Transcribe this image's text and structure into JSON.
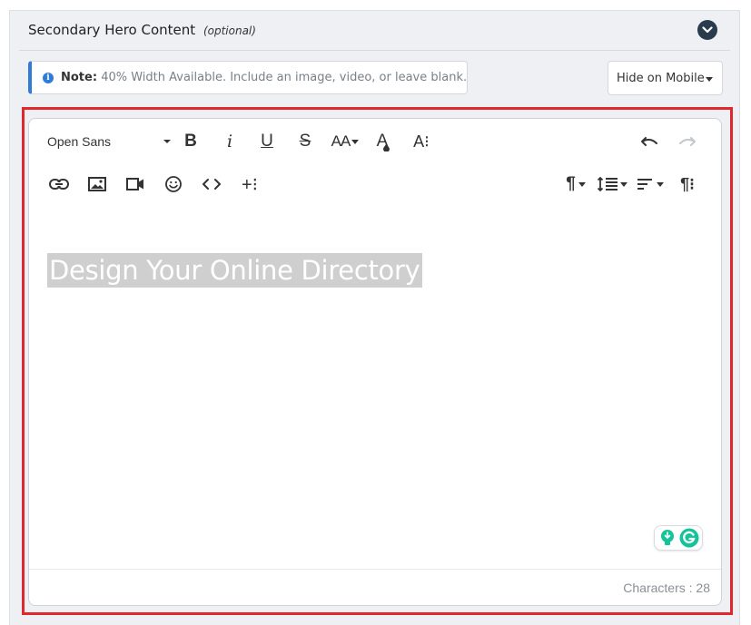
{
  "section": {
    "title": "Secondary Hero Content",
    "optional_label": "(optional)"
  },
  "note": {
    "label": "Note:",
    "text": "40% Width Available. Include an image, video, or leave blank."
  },
  "visibility_select": {
    "value": "Hide on Mobile"
  },
  "toolbar": {
    "font_family": "Open Sans",
    "bold_glyph": "B",
    "italic_glyph": "i",
    "underline_glyph": "U",
    "strike_glyph": "S",
    "font_size_glyph": "AA",
    "text_color_glyph": "A",
    "more_text_glyph": "A⁝",
    "insert_more_glyph": "+⁝",
    "paragraph_glyph": "¶",
    "more_paragraph_glyph": "¶⁝"
  },
  "editor": {
    "content": "Design Your Online Directory",
    "char_count_label": "Characters : 28"
  },
  "colors": {
    "accent_blue": "#2f7bd6",
    "highlight_red": "#e0282e",
    "grammarly_green": "#15c39a"
  }
}
